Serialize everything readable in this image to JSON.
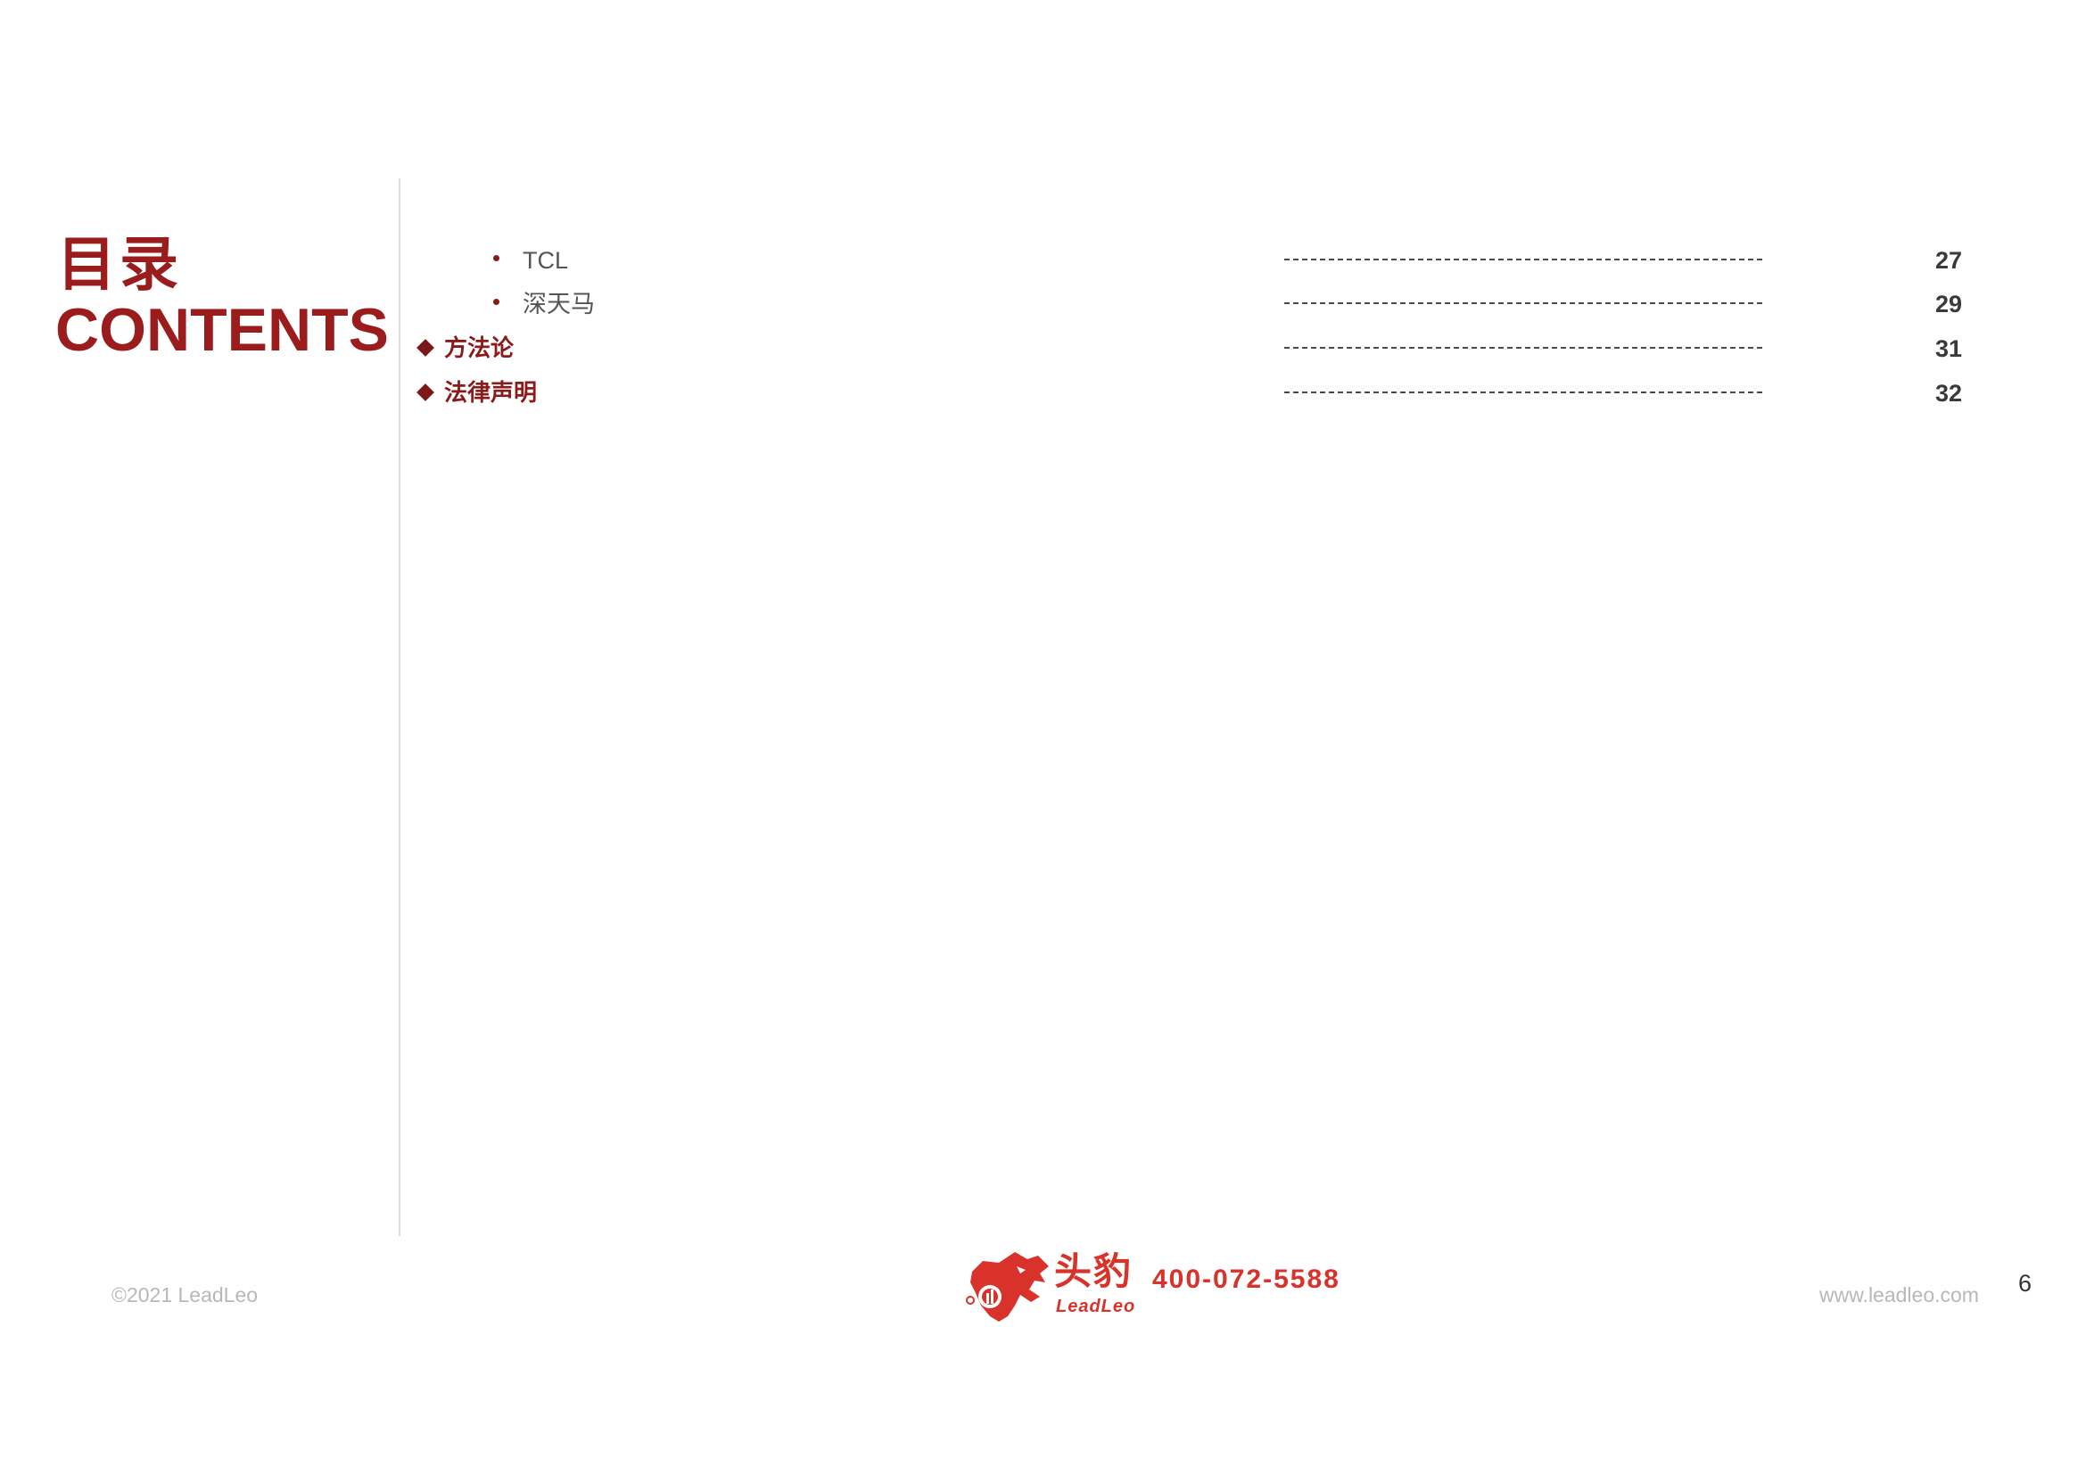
{
  "title": {
    "cn": "目录",
    "en": "CONTENTS"
  },
  "toc": [
    {
      "label": "TCL",
      "page": "27",
      "level": "sub"
    },
    {
      "label": "深天马",
      "page": "29",
      "level": "sub"
    },
    {
      "label": "方法论",
      "page": "31",
      "level": "main"
    },
    {
      "label": "法律声明",
      "page": "32",
      "level": "main"
    }
  ],
  "footer": {
    "copyright": "©2021 LeadLeo",
    "brand_cn": "头豹",
    "brand_en": "LeadLeo",
    "hotline": "400-072-5588",
    "website": "www.leadleo.com",
    "page_number": "6"
  },
  "colors": {
    "accent": "#9b1c1c",
    "brand": "#d8322a"
  }
}
